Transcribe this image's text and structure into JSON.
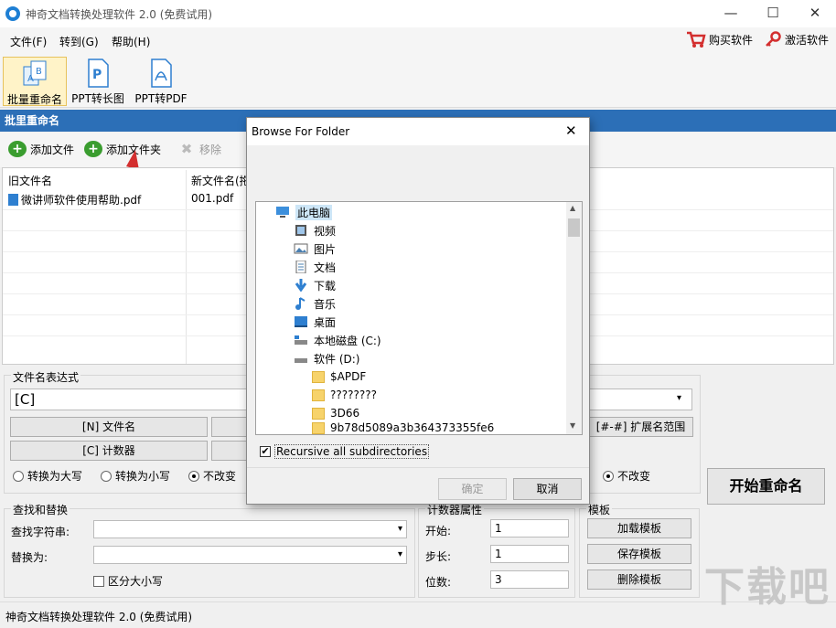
{
  "window": {
    "title": "神奇文档转换处理软件 2.0 (免费试用)",
    "minimize_glyph": "—",
    "maximize_glyph": "☐",
    "close_glyph": "✕"
  },
  "menu": {
    "items": [
      "文件(F)",
      "转到(G)",
      "帮助(H)"
    ],
    "buy_label": "购买软件",
    "activate_label": "激活软件"
  },
  "toolbar": {
    "items": [
      {
        "label": "批量重命名",
        "icon": "rename-batch-icon",
        "active": true
      },
      {
        "label": "PPT转长图",
        "icon": "ppt-icon"
      },
      {
        "label": "PPT转PDF",
        "icon": "pdf-icon"
      }
    ]
  },
  "section": {
    "title": "批里重命名"
  },
  "file_toolbar": {
    "add_file": "添加文件",
    "add_folder": "添加文件夹",
    "remove": "移除"
  },
  "file_list": {
    "columns": [
      "旧文件名",
      "新文件名(拖"
    ],
    "rows": [
      {
        "old": "微讲师软件使用帮助.pdf",
        "new": "001.pdf"
      }
    ]
  },
  "expression": {
    "label": "文件名表达式",
    "value": "[C]",
    "btn_name": "[N] 文件名",
    "btn_counter": "[C] 计数器",
    "btn_ext_range": "[#-#] 扩展名范围",
    "radio_upper": "转换为大写",
    "radio_lower": "转换为小写",
    "radio_nochange": "不改变",
    "radio_ext_nochange": "不改变"
  },
  "find_replace": {
    "title": "查找和替换",
    "find_label": "查找字符串:",
    "replace_label": "替换为:",
    "case_label": "区分大小写"
  },
  "counter": {
    "title": "计数器属性",
    "start_label": "开始:",
    "start_value": "1",
    "step_label": "步长:",
    "step_value": "1",
    "digits_label": "位数:",
    "digits_value": "3"
  },
  "template": {
    "title": "模板",
    "load": "加载模板",
    "save": "保存模板",
    "delete": "删除模板"
  },
  "start_button": "开始重命名",
  "status": "神奇文档转换处理软件 2.0 (免费试用)",
  "dialog": {
    "title": "Browse For Folder",
    "close_glyph": "✕",
    "tree": [
      {
        "label": "此电脑",
        "icon": "computer-icon",
        "selected": true
      },
      {
        "label": "视频",
        "icon": "video-folder-icon"
      },
      {
        "label": "图片",
        "icon": "pictures-folder-icon"
      },
      {
        "label": "文档",
        "icon": "documents-folder-icon"
      },
      {
        "label": "下载",
        "icon": "download-icon"
      },
      {
        "label": "音乐",
        "icon": "music-icon"
      },
      {
        "label": "桌面",
        "icon": "desktop-icon"
      },
      {
        "label": "本地磁盘 (C:)",
        "icon": "drive-icon"
      },
      {
        "label": "软件 (D:)",
        "icon": "drive-icon"
      },
      {
        "label": "$APDF",
        "icon": "folder-icon"
      },
      {
        "label": "????????",
        "icon": "folder-icon"
      },
      {
        "label": "3D66",
        "icon": "folder-icon"
      },
      {
        "label": "9b78d5089a3b364373355fe6",
        "icon": "folder-icon"
      }
    ],
    "recursive_label": "Recursive all subdirectories",
    "ok": "确定",
    "cancel": "取消"
  },
  "watermark": "下载吧",
  "colors": {
    "accent": "#2c6fb7",
    "selection": "#cde6f7",
    "folder": "#f7d36b",
    "arrow": "#d32f2f"
  }
}
